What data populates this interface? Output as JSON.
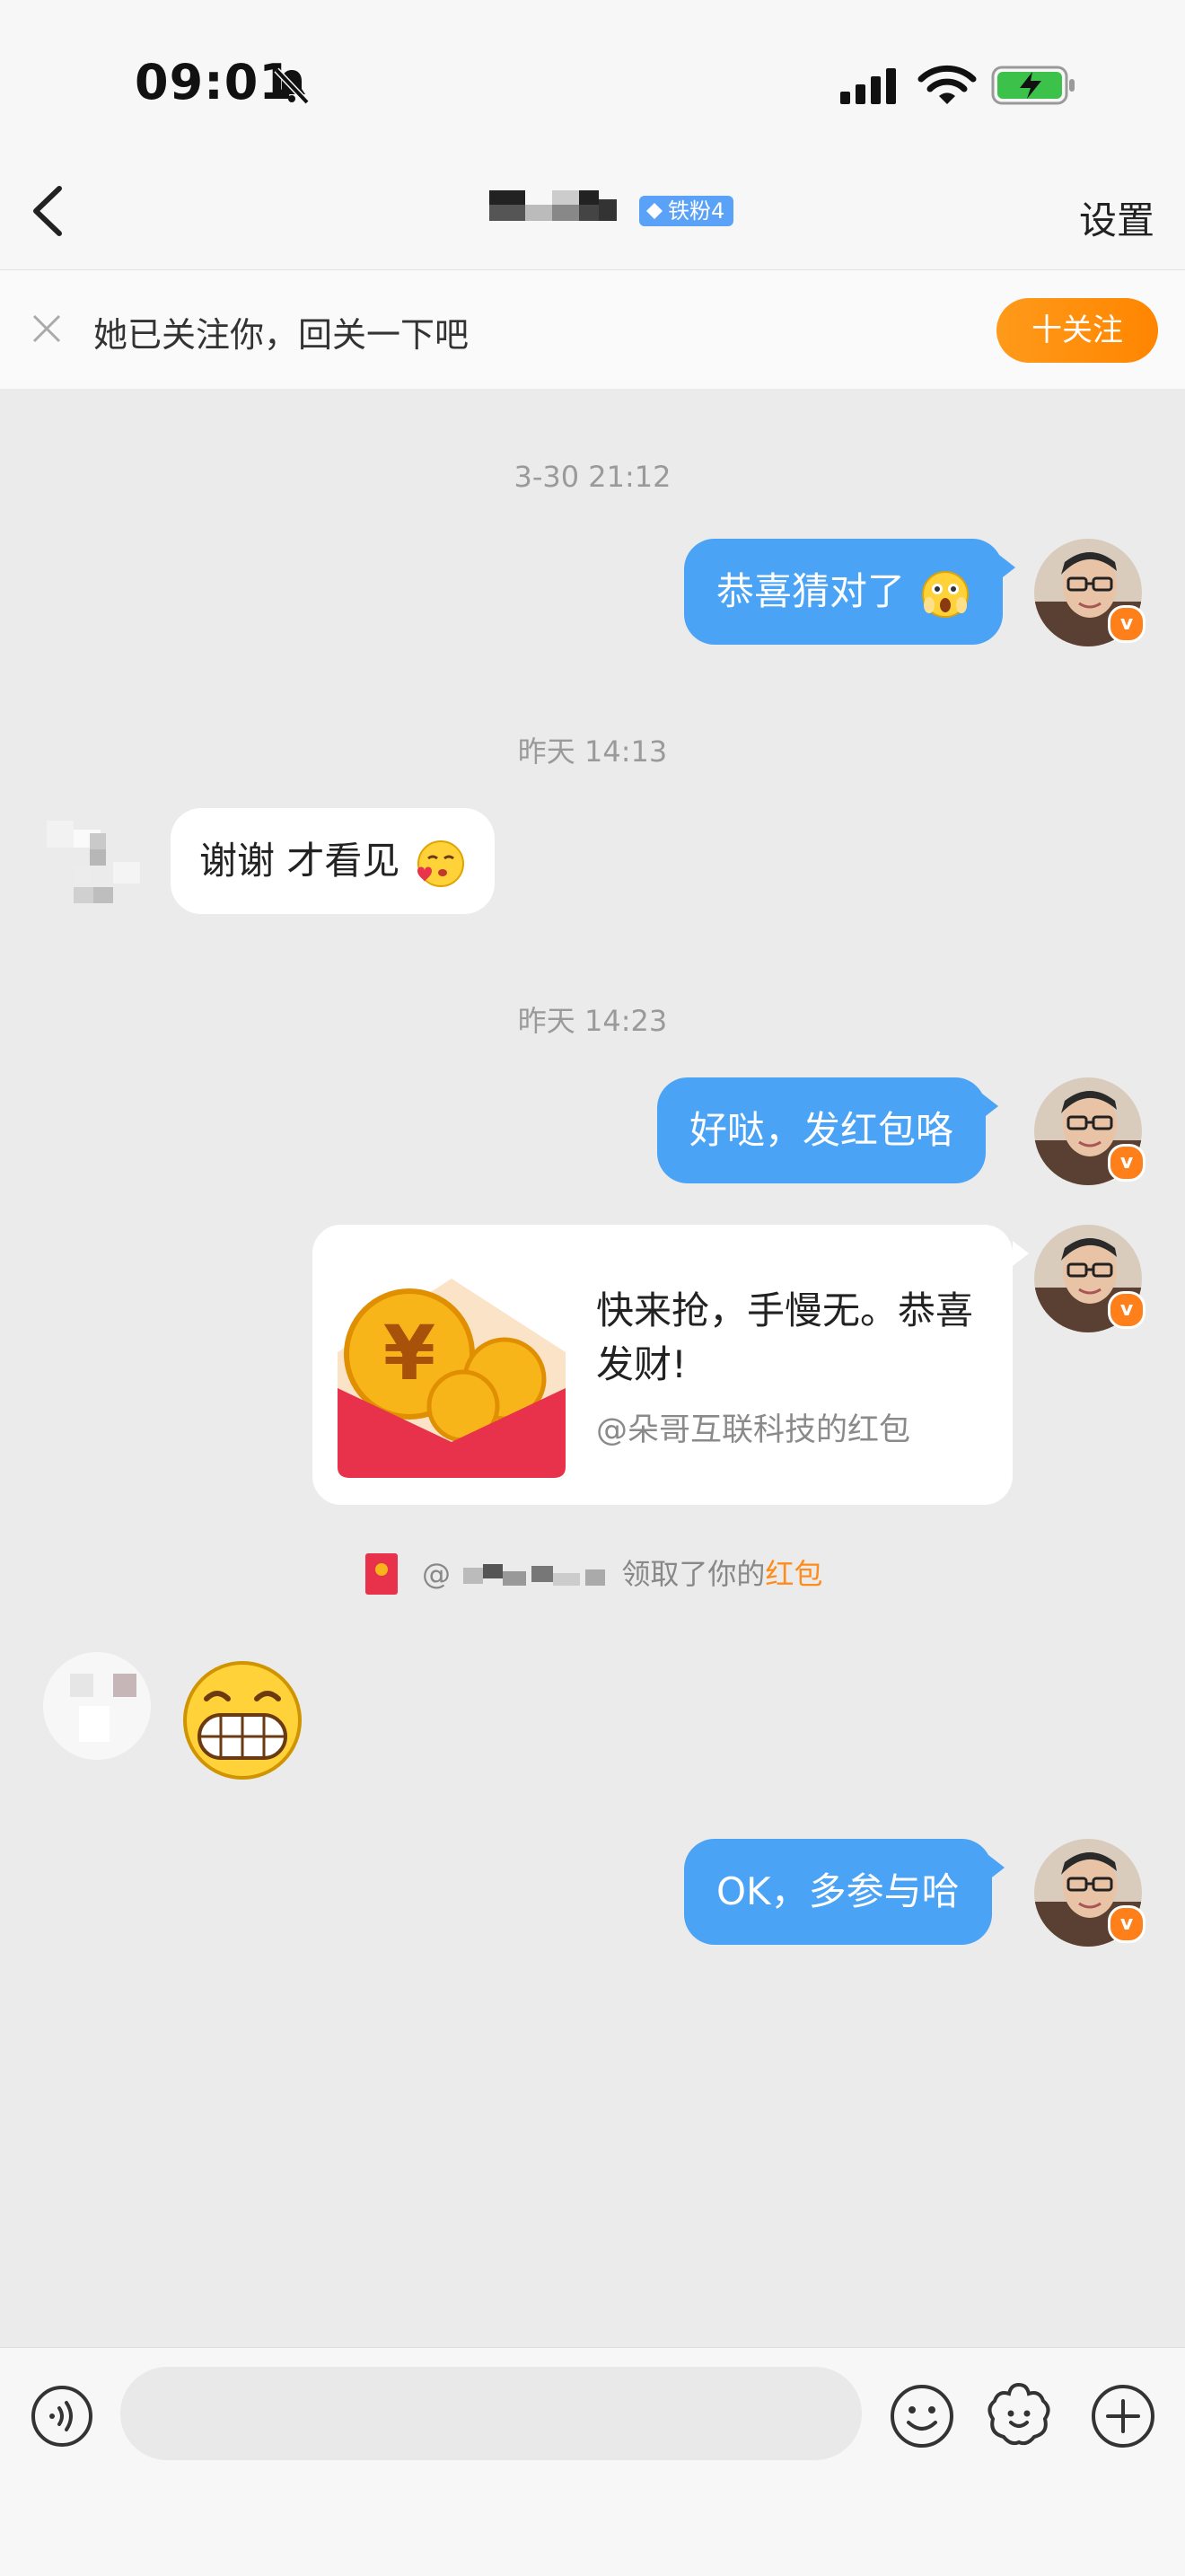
{
  "status_bar": {
    "time": "09:01"
  },
  "header": {
    "fan_badge": "铁粉4",
    "settings_label": "设置"
  },
  "follow_bar": {
    "text": "她已关注你，回关一下吧",
    "button_label": "十关注"
  },
  "messages": {
    "time1": "3-30 21:12",
    "msg1": "恭喜猜对了",
    "time2": "昨天 14:13",
    "msg2": "谢谢 才看见",
    "time3": "昨天 14:23",
    "msg3": "好哒，发红包咯",
    "red_packet": {
      "title": "快来抢，手慢无。恭喜发财!",
      "subtitle": "@朵哥互联科技的红包"
    },
    "claim_prefix": "@",
    "claim_text": "领取了你的",
    "claim_link": "红包",
    "msg5": "OK，多参与哈"
  },
  "input_bar": {
    "placeholder": ""
  },
  "colors": {
    "accent_blue": "#4ba3f5",
    "accent_orange": "#ff8b1a"
  }
}
